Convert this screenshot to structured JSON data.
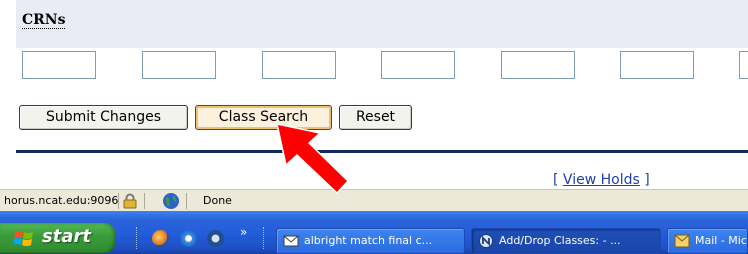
{
  "page": {
    "crns_label": "CRNs",
    "crn_inputs": [
      "",
      "",
      "",
      "",
      "",
      "",
      ""
    ],
    "buttons": {
      "submit": "Submit Changes",
      "class_search": "Class Search",
      "reset": "Reset"
    },
    "holds_link": {
      "open_bracket": "[ ",
      "label": "View Holds",
      "close_bracket": " ]"
    },
    "annotation": {
      "icon": "red-arrow-icon",
      "color": "#ff0000",
      "points_to": "class-search-button"
    }
  },
  "status_bar": {
    "host": "horus.ncat.edu:9096",
    "lock_icon": "lock-icon",
    "zone_icon": "internet-globe-icon",
    "status_text": "Done"
  },
  "taskbar": {
    "start_label": "start",
    "quick_launch": [
      "firefox-icon",
      "internet-explorer-icon",
      "netscape-icon"
    ],
    "more_chevron": "»",
    "tasks": [
      {
        "label": "albright match final c...",
        "icon": "mail-icon"
      },
      {
        "label": "Add/Drop Classes: - ...",
        "icon": "netscape-icon"
      },
      {
        "label": "Mail - Mic",
        "icon": "mail-window-icon"
      }
    ]
  }
}
